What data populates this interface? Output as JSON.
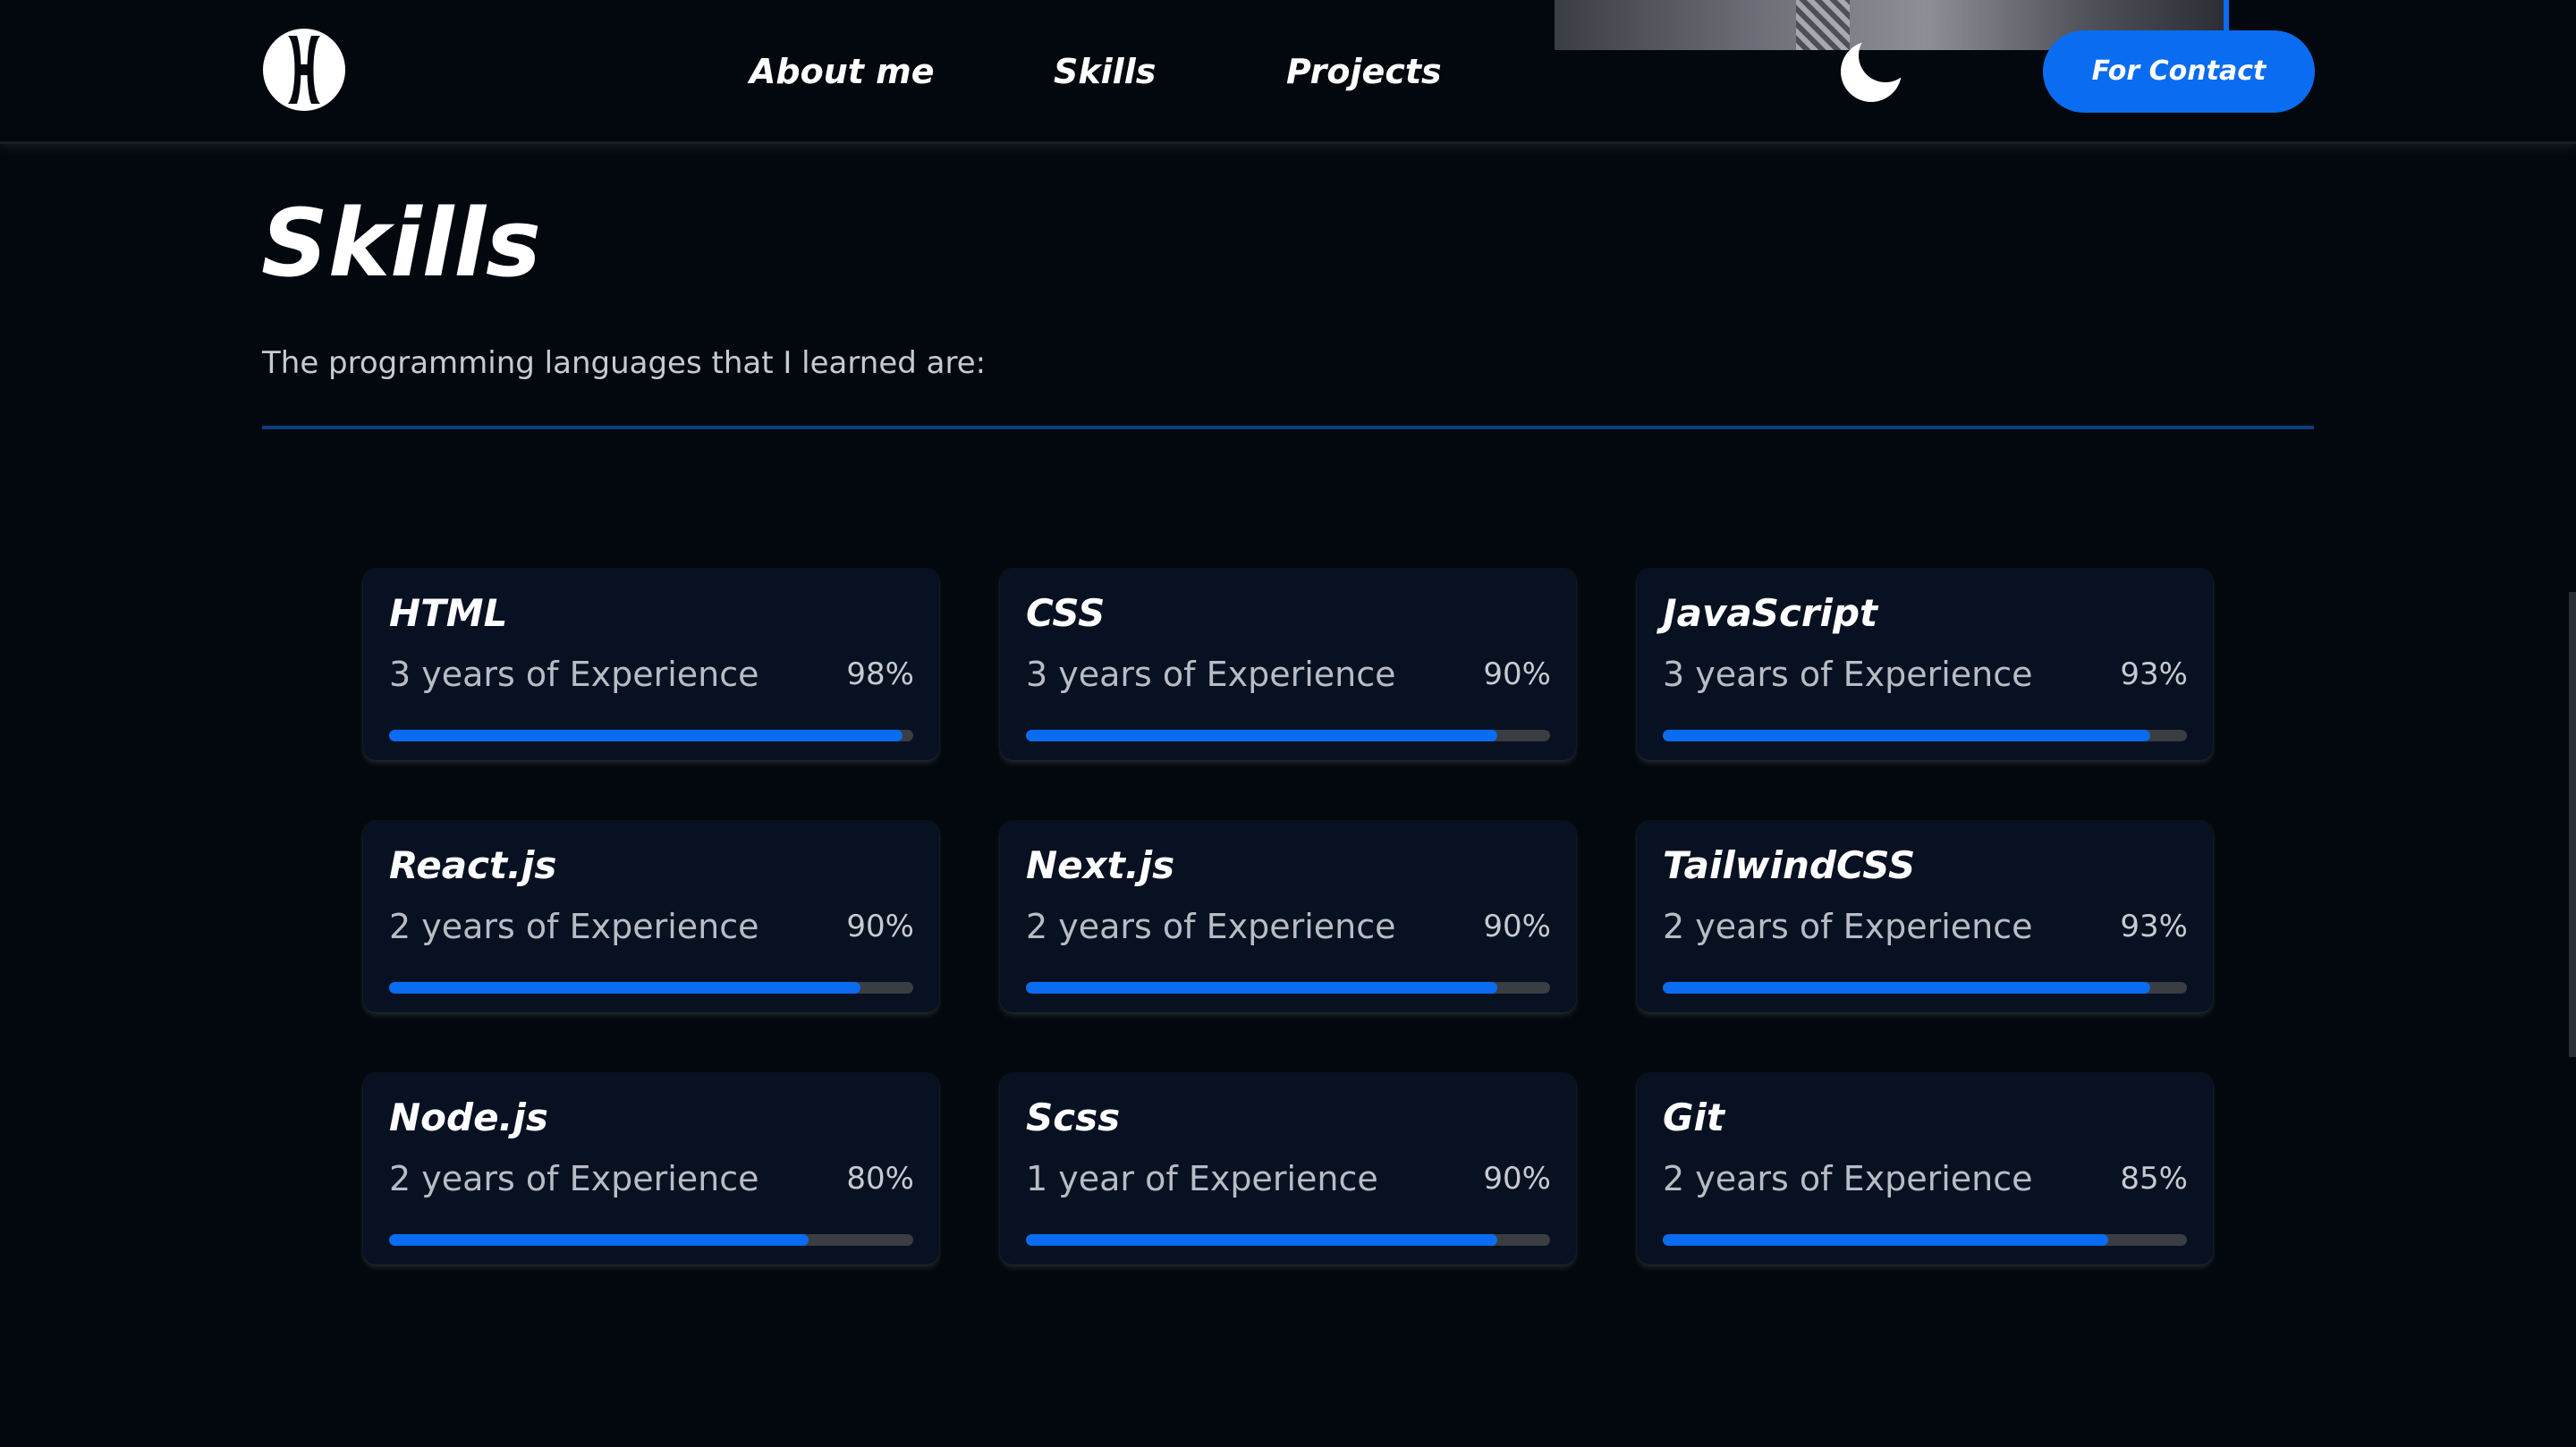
{
  "header": {
    "nav": [
      "About me",
      "Skills",
      "Projects"
    ],
    "contact_label": "For Contact"
  },
  "main": {
    "title": "Skills",
    "subtitle": "The programming languages that I learned are:"
  },
  "skills": [
    {
      "name": "HTML",
      "experience": "3 years of Experience",
      "percent_label": "98%",
      "level": 0.98
    },
    {
      "name": "CSS",
      "experience": "3 years of Experience",
      "percent_label": "90%",
      "level": 0.9
    },
    {
      "name": "JavaScript",
      "experience": "3 years of Experience",
      "percent_label": "93%",
      "level": 0.93
    },
    {
      "name": "React.js",
      "experience": "2 years of Experience",
      "percent_label": "90%",
      "level": 0.9
    },
    {
      "name": "Next.js",
      "experience": "2 years of Experience",
      "percent_label": "90%",
      "level": 0.9
    },
    {
      "name": "TailwindCSS",
      "experience": "2 years of Experience",
      "percent_label": "93%",
      "level": 0.93
    },
    {
      "name": "Node.js",
      "experience": "2 years of Experience",
      "percent_label": "80%",
      "level": 0.8
    },
    {
      "name": "Scss",
      "experience": "1 year of Experience",
      "percent_label": "90%",
      "level": 0.9
    },
    {
      "name": "Git",
      "experience": "2 years of Experience",
      "percent_label": "85%",
      "level": 0.85
    }
  ],
  "colors": {
    "background": "#03080f",
    "accent": "#0a6cf0",
    "card": "#081121",
    "track": "#3a3d42"
  },
  "icons": {
    "logo": "monogram-logo-icon",
    "theme": "moon-icon"
  }
}
